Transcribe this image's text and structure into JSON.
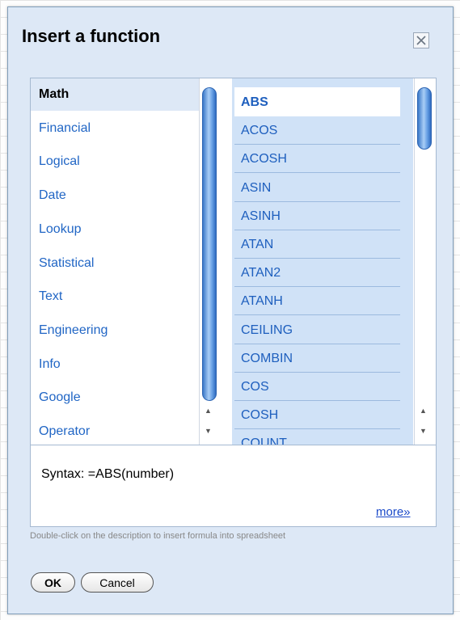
{
  "dialog": {
    "title": "Insert a function"
  },
  "categories": [
    "Math",
    "Financial",
    "Logical",
    "Date",
    "Lookup",
    "Statistical",
    "Text",
    "Engineering",
    "Info",
    "Google",
    "Operator"
  ],
  "selected_category": "Math",
  "functions": [
    "ABS",
    "ACOS",
    "ACOSH",
    "ASIN",
    "ASINH",
    "ATAN",
    "ATAN2",
    "ATANH",
    "CEILING",
    "COMBIN",
    "COS",
    "COSH",
    "COUNT"
  ],
  "selected_function": "ABS",
  "description": {
    "syntax": "Syntax: =ABS(number)",
    "more_link": "more»"
  },
  "hint": "Double-click on the description to insert formula into spreadsheet",
  "buttons": {
    "ok": "OK",
    "cancel": "Cancel"
  },
  "icons": {
    "close": "close-icon",
    "scroll_up": "arrow-up-icon",
    "scroll_down": "arrow-down-icon"
  },
  "colors": {
    "link": "#2166c5",
    "selection_bg": "#dde8f6",
    "function_list_bg": "#d0e2f7"
  }
}
